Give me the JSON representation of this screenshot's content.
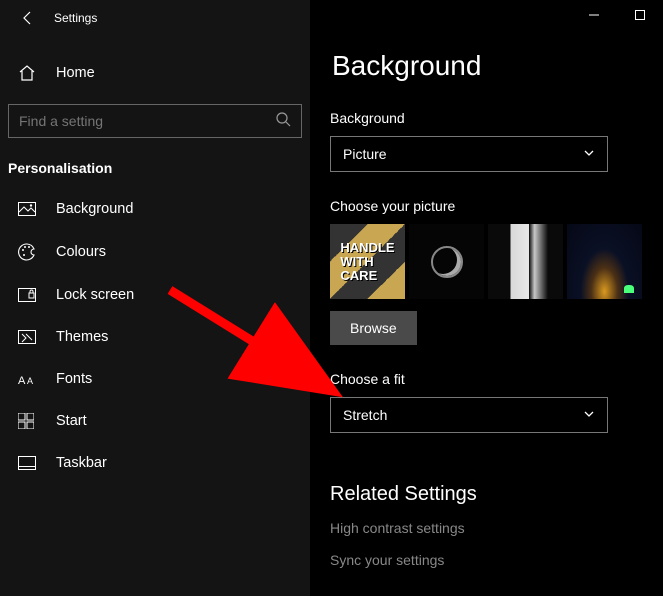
{
  "titlebar": {
    "app_title": "Settings"
  },
  "home": {
    "label": "Home"
  },
  "search": {
    "placeholder": "Find a setting"
  },
  "section_title": "Personalisation",
  "nav": [
    {
      "label": "Background"
    },
    {
      "label": "Colours"
    },
    {
      "label": "Lock screen"
    },
    {
      "label": "Themes"
    },
    {
      "label": "Fonts"
    },
    {
      "label": "Start"
    },
    {
      "label": "Taskbar"
    }
  ],
  "page": {
    "title": "Background",
    "background_label": "Background",
    "background_value": "Picture",
    "choose_picture_label": "Choose your picture",
    "browse_label": "Browse",
    "fit_label": "Choose a fit",
    "fit_value": "Stretch",
    "related_title": "Related Settings",
    "related_links": [
      "High contrast settings",
      "Sync your settings"
    ]
  }
}
